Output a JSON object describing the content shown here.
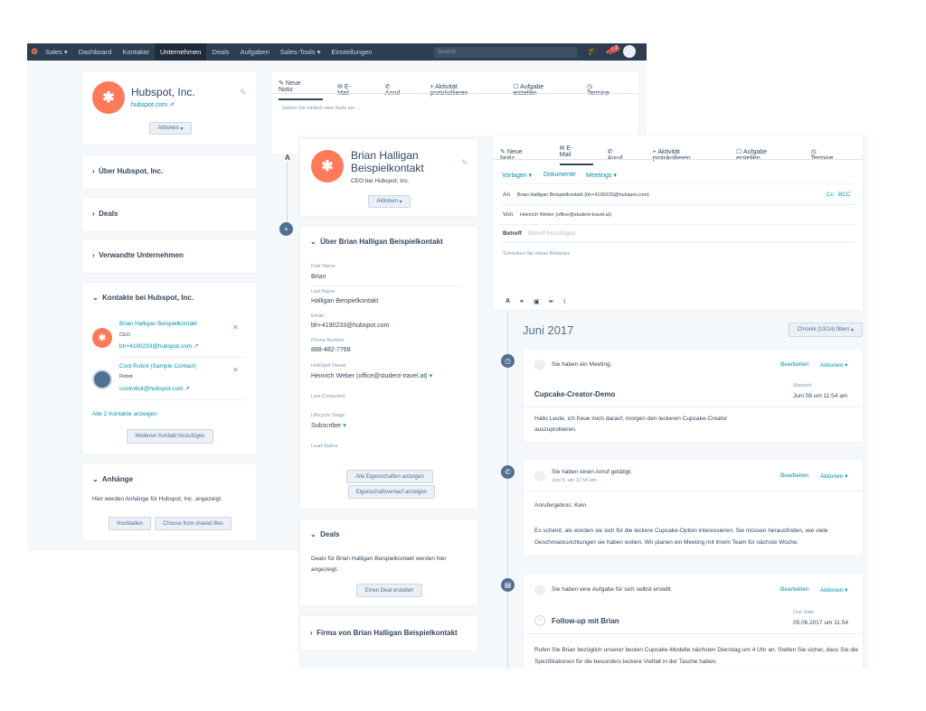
{
  "nav": {
    "brand": "Sales",
    "items": [
      "Dashboard",
      "Kontakte",
      "Unternehmen",
      "Deals",
      "Aufgaben",
      "Sales-Tools",
      "Einstellungen"
    ],
    "active": "Unternehmen",
    "search_placeholder": "Search",
    "notif_count": "1"
  },
  "company": {
    "name": "Hubspot, Inc.",
    "domain": "hubspot.com",
    "actions_label": "Aktionen",
    "sections": [
      "Über Hubspot, Inc.",
      "Deals",
      "Verwandte Unternehmen"
    ],
    "contacts_title": "Kontakte bei Hubspot, Inc.",
    "contacts": [
      {
        "name": "Brian Halligan Beispielkontakt",
        "title": "CEO",
        "email": "bh+4190233@hubspot.com"
      },
      {
        "name": "Cool Robot (Sample Contact)",
        "title": "Robot",
        "email": "coolrobot@hubspot.com"
      }
    ],
    "show_all": "Alle 2 Kontakte anzeigen",
    "add_contact": "Weiteren Kontakt hinzufügen",
    "attachments_title": "Anhänge",
    "attachments_text": "Hier werden Anhänge für Hubspot, Inc. angezeigt.",
    "upload": "Hochladen",
    "choose_shared": "Choose from shared files"
  },
  "back_tabs": {
    "items": [
      "Neue Notiz",
      "E-Mail",
      "Anruf",
      "Aktivität protokollieren",
      "Aufgabe erstellen",
      "Termine"
    ],
    "note_placeholder": "Geben Sie einfach eine Notiz ein ..."
  },
  "contact": {
    "name": "Brian Halligan Beispielkontakt",
    "subtitle": "CEO bei Hubspot, Inc.",
    "actions_label": "Aktionen",
    "about_title": "Über Brian Halligan Beispielkontakt",
    "props": [
      {
        "label": "First Name",
        "value": "Brian"
      },
      {
        "label": "Last Name",
        "value": "Halligan Beispielkontakt"
      },
      {
        "label": "Email",
        "value": "bh+4190233@hubspot.com"
      },
      {
        "label": "Phone Number",
        "value": "888-482-7768"
      },
      {
        "label": "HubSpot Owner",
        "value": "Heinrich Weber (office@student-travel.at)"
      },
      {
        "label": "Last Contacted",
        "value": ""
      },
      {
        "label": "Lifecycle Stage",
        "value": "Subscriber"
      },
      {
        "label": "Lead Status",
        "value": ""
      }
    ],
    "all_props": "Alle Eigenschaften anzeigen",
    "prop_history": "Eigenschaftsverlauf anzeigen",
    "deals_title": "Deals",
    "deals_text": "Deals für Brian Halligan Beispielkontakt werden hier angezeigt.",
    "create_deal": "Einen Deal erstellen",
    "company_title": "Firma von Brian Halligan Beispielkontakt"
  },
  "email": {
    "tabs": [
      "Neue Notiz",
      "E-Mail",
      "Anruf",
      "Aktivität protokollieren",
      "Aufgabe erstellen",
      "Termine"
    ],
    "active_tab": "E-Mail",
    "toolbar": [
      "Vorlagen",
      "Dokumente",
      "Meetings"
    ],
    "to_label": "An",
    "to_value": "Brian Halligan Beispielkontakt (bh+4190233@hubspot.com)",
    "cc": "Cc",
    "bcc": "BCC",
    "from_label": "Von",
    "from_value": "Heinrich Weber (office@student-travel.at)",
    "subject_label": "Betreff",
    "subject_placeholder": "Betreff hinzufügen",
    "body_placeholder": "Schreiben Sie etwas Brillantes"
  },
  "timeline": {
    "month": "Juni 2017",
    "filter": "Chronik (13/14) filtern",
    "edit": "Bearbeiten",
    "actions": "Aktionen",
    "events": [
      {
        "title": "Sie haben ein Meeting.",
        "sub": "",
        "heading": "Cupcake-Creator-Demo",
        "date_label": "Startzeit",
        "date": "Juni 08 um 11:54 am",
        "body": "Hallo Leute, ich freue mich darauf, morgen den leckeren Cupcake-Creator auszuprobieren."
      },
      {
        "title": "Sie haben einen Anruf getätigt.",
        "sub": "Juni 5. um 11:54 am",
        "heading": "Anrufergebnis: Kein",
        "date_label": "",
        "date": "",
        "body": "Es scheint, als würden sie sich für die leckere Cupcake-Option interessieren. Sie müssen herausfinden, wie viele Geschmacksrichtungen sie haben wollen. Wir planen ein Meeting mit ihrem Team für nächste Woche."
      },
      {
        "title": "Sie haben eine Aufgabe für sich selbst erstellt.",
        "sub": "",
        "heading": "Follow-up mit Brian",
        "date_label": "Due Date",
        "date": "05.06.2017 um 11:54",
        "body": "Rufen Sie Brian bezüglich unserer besten Cupcake-Modelle nächsten Dienstag um 4 Uhr an. Stellen Sie sicher, dass Sie die Spezifikationen für die besonders leckere Vielfalt in der Tasche haben."
      }
    ]
  }
}
